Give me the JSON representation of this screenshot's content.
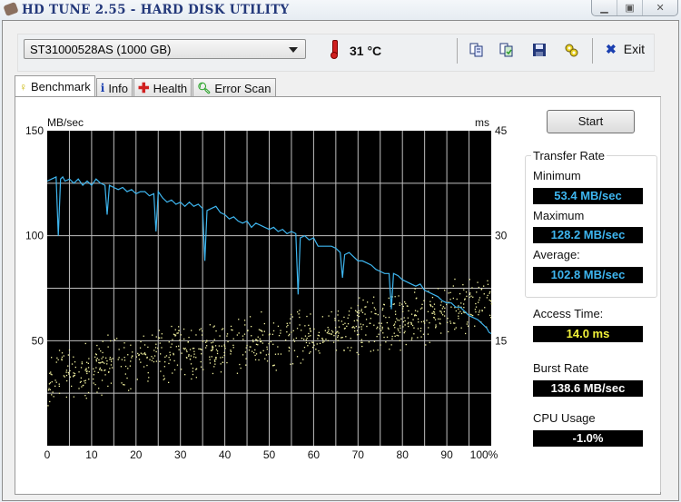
{
  "window": {
    "title": "HD TUNE 2.55 - HARD DISK UTILITY",
    "controls": {
      "minimize": "minimize-icon",
      "maximize": "maximize-icon",
      "close": "close-icon"
    }
  },
  "toolbar": {
    "drive": "ST31000528AS (1000 GB)",
    "temperature": "31 °C",
    "icons": [
      "copy-info-icon",
      "copy-screenshot-icon",
      "save-icon",
      "options-icon"
    ],
    "exit_label": "Exit"
  },
  "tabs": [
    {
      "label": "Benchmark",
      "icon": "lightbulb-icon",
      "active": true
    },
    {
      "label": "Info",
      "icon": "info-icon",
      "active": false
    },
    {
      "label": "Health",
      "icon": "health-cross-icon",
      "active": false
    },
    {
      "label": "Error Scan",
      "icon": "magnifier-icon",
      "active": false
    }
  ],
  "benchmark": {
    "start_label": "Start",
    "transfer_rate": {
      "title": "Transfer Rate",
      "minimum_label": "Minimum",
      "minimum": "53.4 MB/sec",
      "maximum_label": "Maximum",
      "maximum": "128.2 MB/sec",
      "average_label": "Average:",
      "average": "102.8 MB/sec"
    },
    "access_time_label": "Access Time:",
    "access_time": "14.0 ms",
    "burst_rate_label": "Burst Rate",
    "burst_rate": "138.6 MB/sec",
    "cpu_usage_label": "CPU Usage",
    "cpu_usage": "-1.0%"
  },
  "colors": {
    "transfer_line": "#3eb6f0",
    "access_dots": "#f2f2a0",
    "plot_bg": "#000000",
    "grid": "#bfbfbf"
  },
  "chart_data": {
    "type": "line",
    "title": "",
    "xlabel": "",
    "ylabel": "MB/sec",
    "y2label": "ms",
    "xlim": [
      0,
      100
    ],
    "ylim": [
      0,
      150
    ],
    "y2lim": [
      0,
      45
    ],
    "x_ticks": [
      "0",
      "10",
      "20",
      "30",
      "40",
      "50",
      "60",
      "70",
      "80",
      "90",
      "100%"
    ],
    "y_ticks": [
      "150",
      "100",
      "50"
    ],
    "y2_ticks": [
      "45",
      "30",
      "15"
    ],
    "grid": true,
    "series": [
      {
        "name": "Transfer Rate (MB/sec)",
        "axis": "left",
        "x": [
          0,
          1,
          2,
          2.5,
          3,
          3.5,
          4,
          5,
          6,
          7,
          8,
          9,
          10,
          11,
          12,
          13,
          13.5,
          14,
          15,
          16,
          17,
          18,
          19,
          20,
          21,
          22,
          23,
          24,
          24.5,
          25,
          26,
          27,
          28,
          29,
          30,
          31,
          32,
          33,
          34,
          35,
          35.5,
          36,
          37,
          38,
          39,
          40,
          41,
          42,
          43,
          44,
          45,
          46,
          47,
          48,
          49,
          50,
          51,
          52,
          53,
          54,
          55,
          56,
          56.5,
          57,
          58,
          59,
          60,
          61,
          62,
          63,
          64,
          65,
          66,
          66.5,
          67,
          68,
          69,
          70,
          71,
          72,
          73,
          74,
          75,
          76,
          77,
          77.5,
          78,
          79,
          80,
          81,
          82,
          83,
          84,
          85,
          86,
          87,
          88,
          89,
          90,
          91,
          92,
          93,
          94,
          95,
          96,
          97,
          98,
          99,
          99.5,
          100
        ],
        "values": [
          126,
          127,
          128,
          100,
          127,
          128,
          126,
          127,
          125,
          127,
          124,
          126,
          124,
          127,
          125,
          124,
          110,
          124,
          123,
          122,
          123,
          121,
          122,
          120,
          121,
          121,
          119,
          120,
          102,
          121,
          118,
          116,
          117,
          115,
          116,
          114,
          116,
          114,
          115,
          113,
          88,
          112,
          113,
          114,
          111,
          110,
          108,
          109,
          107,
          106,
          107,
          104,
          106,
          105,
          104,
          103,
          104,
          102,
          103,
          101,
          102,
          101,
          72,
          99,
          100,
          98,
          99,
          95,
          95,
          95,
          95,
          94,
          92,
          80,
          91,
          92,
          90,
          88,
          88,
          87,
          86,
          84,
          83,
          82,
          82,
          65,
          82,
          81,
          79,
          78,
          77,
          76,
          77,
          74,
          73,
          72,
          71,
          69,
          68,
          68,
          66,
          66,
          64,
          62,
          61,
          60,
          58,
          56,
          54,
          53.4
        ]
      },
      {
        "name": "Access Time (ms)",
        "axis": "right",
        "type": "scatter",
        "trend_x": [
          0,
          10,
          20,
          30,
          40,
          50,
          60,
          70,
          80,
          90,
          100
        ],
        "trend_values": [
          10,
          11,
          12.5,
          13.5,
          14.2,
          15,
          15.8,
          17,
          18,
          19.5,
          20.5
        ],
        "spread_ms": 3.5,
        "point_count": 900
      }
    ]
  }
}
